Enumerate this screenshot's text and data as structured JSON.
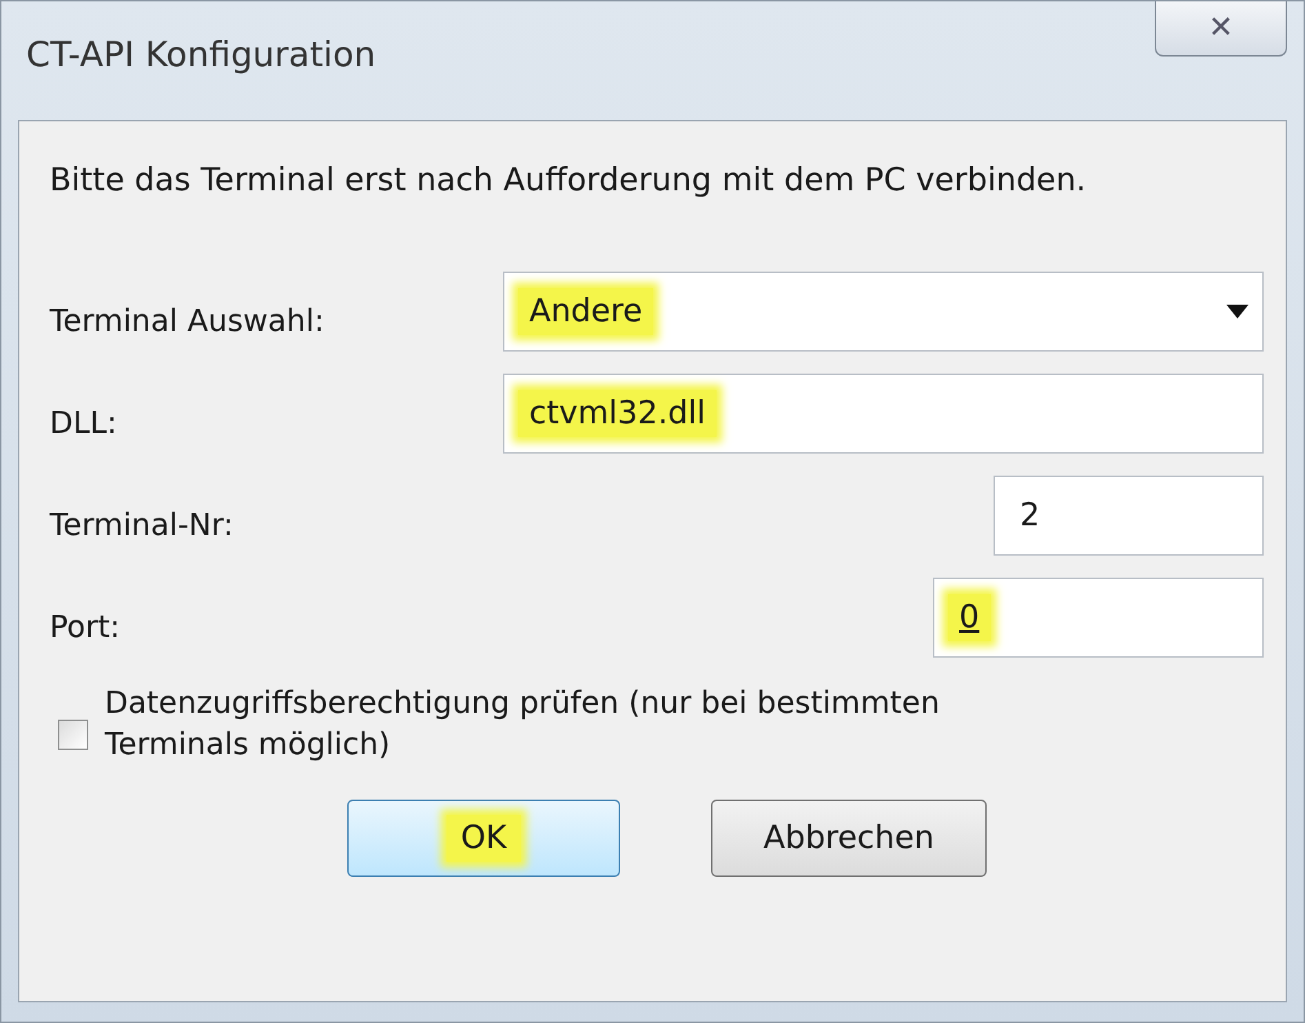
{
  "window": {
    "title": "CT-API Konfiguration",
    "close": "✕"
  },
  "instruction": "Bitte das Terminal erst nach Aufforderung mit dem PC verbinden.",
  "fields": [
    {
      "kind": "dropdown",
      "label": "Terminal Auswahl:",
      "value": "Andere",
      "highlighted": true,
      "underlined": false
    },
    {
      "kind": "text",
      "label": "DLL:",
      "value": "ctvml32.dll",
      "highlighted": true,
      "underlined": false
    },
    {
      "kind": "text",
      "label": "Terminal-Nr:",
      "value": "2",
      "highlighted": false,
      "underlined": false
    },
    {
      "kind": "text",
      "label": "Port:",
      "value": "0",
      "highlighted": true,
      "underlined": true
    }
  ],
  "checkbox": {
    "label": "Datenzugriffsberechtigung prüfen (nur bei bestimmten Terminals möglich)",
    "checked": false
  },
  "buttons": [
    {
      "label": "OK",
      "highlighted": true,
      "default": true
    },
    {
      "label": "Abbrechen",
      "highlighted": false,
      "default": false
    }
  ]
}
